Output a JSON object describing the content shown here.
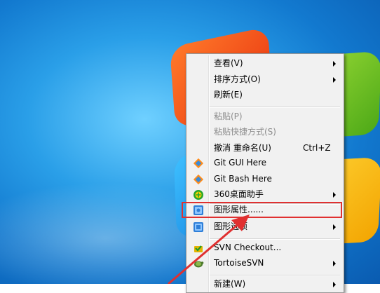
{
  "menu": {
    "items": [
      {
        "label": "查看(V)",
        "submenu": true
      },
      {
        "label": "排序方式(O)",
        "submenu": true
      },
      {
        "label": "刷新(E)"
      },
      {
        "label": "粘贴(P)",
        "disabled": true
      },
      {
        "label": "粘贴快捷方式(S)",
        "disabled": true
      },
      {
        "label": "撤消 重命名(U)",
        "shortcut": "Ctrl+Z"
      },
      {
        "label": "Git GUI Here",
        "icon": "git-gui-icon"
      },
      {
        "label": "Git Bash Here",
        "icon": "git-bash-icon"
      },
      {
        "label": "360桌面助手",
        "icon": "360-desktop-icon",
        "submenu": true
      },
      {
        "label": "图形属性......",
        "icon": "graphics-properties-icon"
      },
      {
        "label": "图形选项",
        "icon": "graphics-options-icon",
        "submenu": true
      },
      {
        "label": "SVN Checkout...",
        "icon": "svn-checkout-icon"
      },
      {
        "label": "TortoiseSVN",
        "icon": "tortoisesvn-icon",
        "submenu": true
      },
      {
        "label": "新建(W)",
        "submenu": true
      }
    ]
  },
  "colors": {
    "menu_bg": "#f1f1f1",
    "highlight_box": "#e03030",
    "arrow": "#e03030",
    "disabled_text": "#8d8d8d"
  }
}
